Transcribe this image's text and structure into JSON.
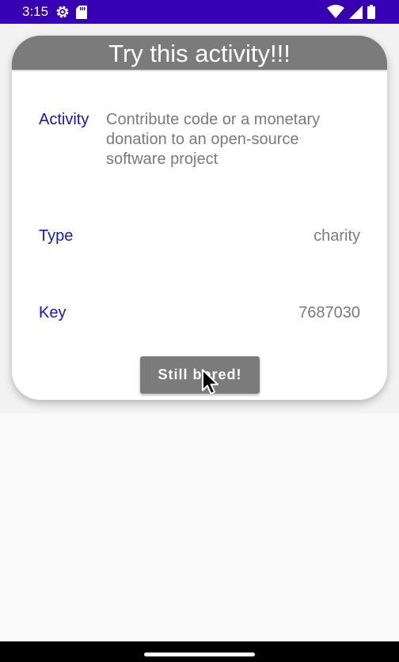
{
  "status_bar": {
    "time": "3:15",
    "left_icons": [
      "settings-gear-icon",
      "sd-card-icon"
    ],
    "right_icons": [
      "wifi-icon",
      "cell-signal-icon",
      "battery-icon"
    ],
    "background_color": "#3700b3"
  },
  "card": {
    "title": "Try this activity!!!",
    "rows": [
      {
        "label": "Activity",
        "value": "Contribute code or a monetary donation to an open-source software project"
      },
      {
        "label": "Type",
        "value": "charity"
      },
      {
        "label": "Key",
        "value": "7687030"
      }
    ],
    "button_label": "Still bored!",
    "header_color": "#7b7b7b",
    "label_color": "#1515c8",
    "value_color": "#7a7a7a"
  }
}
